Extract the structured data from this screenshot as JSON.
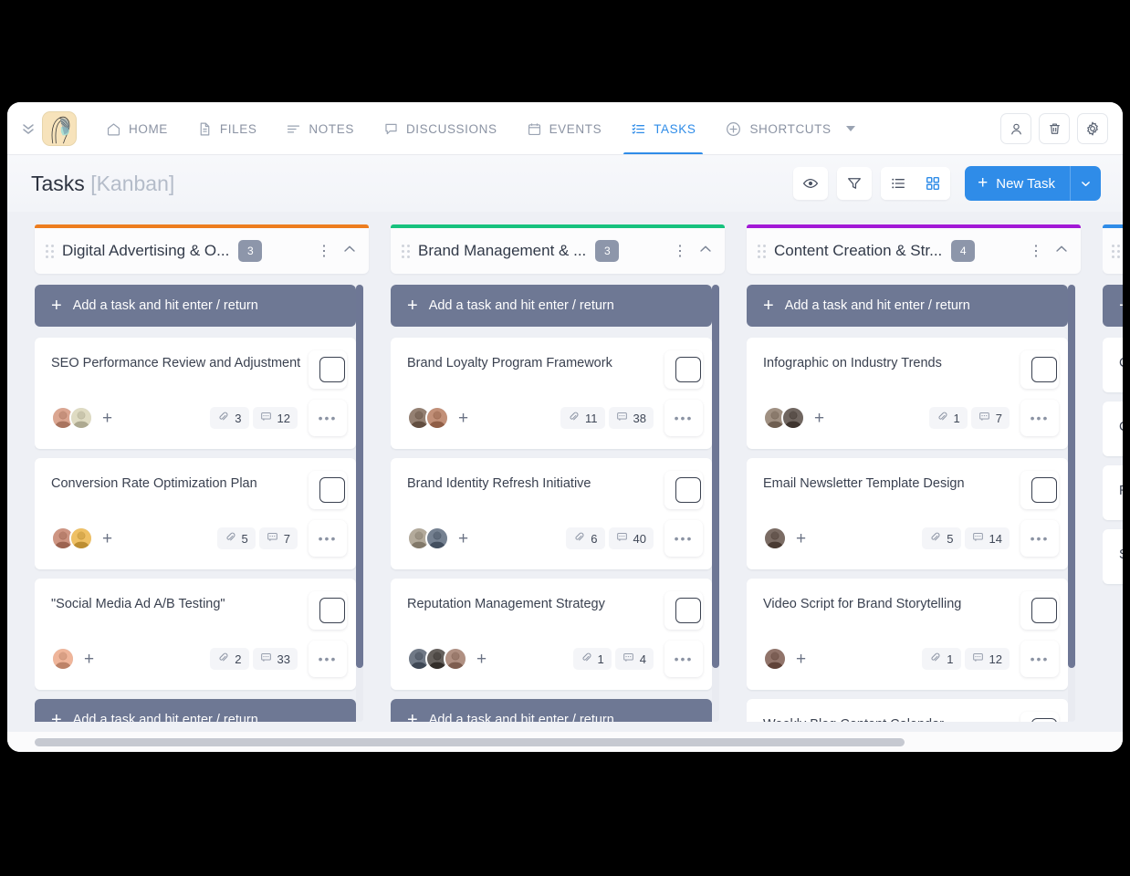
{
  "app": {
    "logo_name": "workspace-logo",
    "collapse_icon": "chevron-double-down-icon"
  },
  "nav": {
    "items": [
      {
        "label": "HOME",
        "icon": "home-icon",
        "active": false
      },
      {
        "label": "FILES",
        "icon": "file-icon",
        "active": false
      },
      {
        "label": "NOTES",
        "icon": "notes-lines-icon",
        "active": false
      },
      {
        "label": "DISCUSSIONS",
        "icon": "chat-icon",
        "active": false
      },
      {
        "label": "EVENTS",
        "icon": "calendar-icon",
        "active": false
      },
      {
        "label": "TASKS",
        "icon": "tasks-checklist-icon",
        "active": true
      },
      {
        "label": "SHORTCUTS",
        "icon": "plus-circle-icon",
        "active": false
      }
    ],
    "right_icons": [
      "person-icon",
      "trash-icon",
      "gear-icon"
    ]
  },
  "header": {
    "title": "Tasks",
    "subtitle": "[Kanban]",
    "tools": [
      "eye-icon",
      "filter-icon",
      "list-view-icon",
      "grid-view-icon"
    ],
    "active_view": "grid-view-icon",
    "new_task_label": "New Task",
    "new_task_plus": "+",
    "new_task_caret": "chevron-down-icon",
    "accent_color": "#2f8ce8"
  },
  "board": {
    "add_task_placeholder": "Add a task and hit enter / return",
    "columns": [
      {
        "name": "Digital Advertising & O...",
        "count": "3",
        "color": "#ed7d1f",
        "show_top_add": true,
        "show_bottom_add": true,
        "cards": [
          {
            "title": "SEO Performance Review and Adjustment",
            "avatars": [
              "#b5806b",
              "#b9b59c"
            ],
            "attachments": "3",
            "comments": "12"
          },
          {
            "title": "Conversion Rate Optimization Plan",
            "avatars": [
              "#a86f5c",
              "#c99a3e"
            ],
            "attachments": "5",
            "comments": "7"
          },
          {
            "title": "\"Social Media Ad A/B Testing\"",
            "avatars": [
              "#c98f74"
            ],
            "attachments": "2",
            "comments": "33"
          }
        ]
      },
      {
        "name": "Brand Management & ...",
        "count": "3",
        "color": "#17c27e",
        "show_top_add": true,
        "show_bottom_add": true,
        "cards": [
          {
            "title": "Brand Loyalty Program Framework",
            "avatars": [
              "#6e5a4c",
              "#9c6a52"
            ],
            "attachments": "11",
            "comments": "38"
          },
          {
            "title": "Brand Identity Refresh Initiative",
            "avatars": [
              "#8d8475",
              "#4f5b6b"
            ],
            "attachments": "6",
            "comments": "40"
          },
          {
            "title": "Reputation Management Strategy",
            "avatars": [
              "#4a5360",
              "#3f3a36",
              "#8a6a5c"
            ],
            "attachments": "1",
            "comments": "4"
          }
        ]
      },
      {
        "name": "Content Creation & Str...",
        "count": "4",
        "color": "#a219d6",
        "show_top_add": true,
        "show_bottom_add": false,
        "cards": [
          {
            "title": "Infographic on Industry Trends",
            "avatars": [
              "#7a6a5c",
              "#4a403a"
            ],
            "attachments": "1",
            "comments": "7"
          },
          {
            "title": "Email Newsletter Template Design",
            "avatars": [
              "#55463e"
            ],
            "attachments": "5",
            "comments": "14"
          },
          {
            "title": "Video Script for Brand Storytelling",
            "avatars": [
              "#6b4e44"
            ],
            "attachments": "1",
            "comments": "12"
          },
          {
            "title": "Weekly Blog Content Calendar",
            "avatars": [],
            "attachments": "",
            "comments": "",
            "partial": true
          }
        ]
      },
      {
        "name": "",
        "count": "",
        "color": "#2f8ce8",
        "show_top_add": true,
        "show_bottom_add": false,
        "edge": true,
        "cards": [
          {
            "title": "C",
            "avatars": [],
            "attachments": "",
            "comments": "",
            "partial": true
          },
          {
            "title": "C",
            "avatars": [],
            "attachments": "",
            "comments": "",
            "partial": true
          },
          {
            "title": "R",
            "avatars": [],
            "attachments": "",
            "comments": "",
            "partial": true
          },
          {
            "title": "S",
            "avatars": [],
            "attachments": "",
            "comments": "",
            "partial": true
          }
        ]
      }
    ]
  },
  "scrollbars": {
    "horizontal_position": "left",
    "horizontal_thumb_width_pct": "82"
  }
}
